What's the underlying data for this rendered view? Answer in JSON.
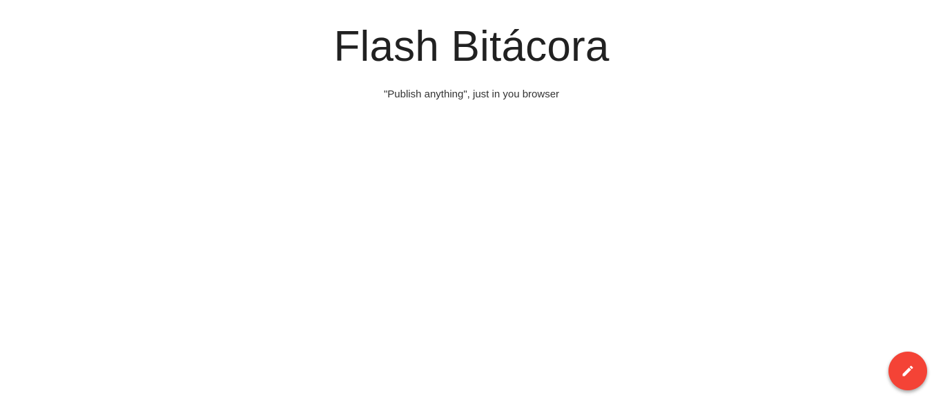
{
  "header": {
    "title": "Flash Bitácora",
    "tagline": "\"Publish anything\", just in you browser"
  },
  "fab": {
    "icon": "pencil-icon",
    "color": "#f44336"
  }
}
